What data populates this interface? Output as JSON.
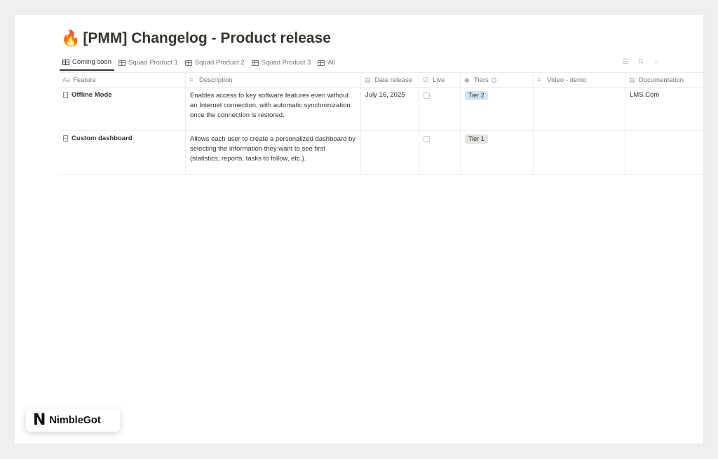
{
  "page": {
    "title_emoji": "🔥",
    "title": "[PMM] Changelog - Product release"
  },
  "tabs": [
    {
      "label": "Coming soon",
      "active": true
    },
    {
      "label": "Squad Product 1",
      "active": false
    },
    {
      "label": "Squad Product 2",
      "active": false
    },
    {
      "label": "Squad Product 3",
      "active": false
    },
    {
      "label": "All",
      "active": false
    }
  ],
  "toolbar": {
    "filter_icon": "filter-icon",
    "sort_icon": "sort-icon",
    "search_icon": "search-icon"
  },
  "table": {
    "columns": [
      {
        "icon": "Aa",
        "label": "Feature"
      },
      {
        "icon": "≡",
        "label": "Description"
      },
      {
        "icon": "▤",
        "label": "Date release"
      },
      {
        "icon": "☑",
        "label": "Live"
      },
      {
        "icon": "◉",
        "label": "Tiers"
      },
      {
        "icon": "≡",
        "label": "Video - demo"
      },
      {
        "icon": "▤",
        "label": "Documentation"
      }
    ],
    "rows": [
      {
        "feature": "Offline Mode",
        "description": "Enables access to key software features even without an Internet connection, with automatic synchronization once the connection is restored.",
        "date": "July 16, 2025",
        "live": false,
        "tier": "Tier 2",
        "video": "",
        "docs": "LMS.Com"
      },
      {
        "feature": "Custom dashboard",
        "description": "Allows each user to create a personalized dashboard by selecting the information they want to see first (statistics, reports, tasks to follow, etc.).",
        "date": "",
        "live": false,
        "tier": "Tier 1",
        "video": "",
        "docs": ""
      }
    ]
  },
  "badge": {
    "logo_letter": "N",
    "brand": "NimbleGot"
  }
}
